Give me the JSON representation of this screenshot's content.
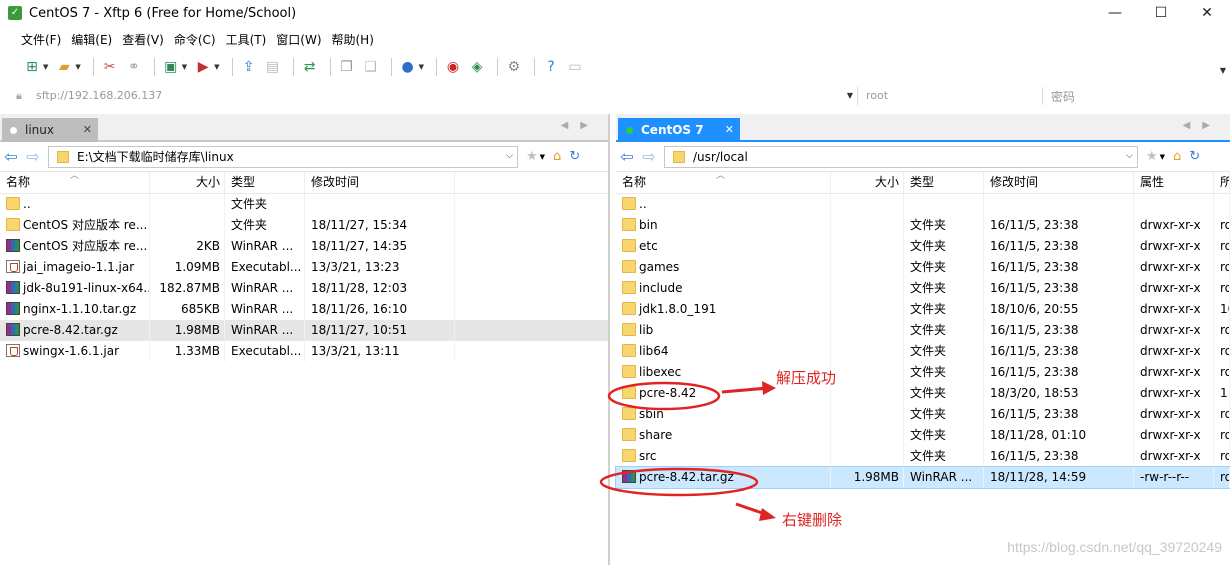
{
  "window": {
    "title": "CentOS 7 - Xftp 6 (Free for Home/School)",
    "controls": [
      "—",
      "☐",
      "✕"
    ]
  },
  "menu": [
    "文件(F)",
    "编辑(E)",
    "查看(V)",
    "命令(C)",
    "工具(T)",
    "窗口(W)",
    "帮助(H)"
  ],
  "address": {
    "host": "sftp://192.168.206.137",
    "user": "root",
    "password_placeholder": "密码"
  },
  "left_pane": {
    "tab_label": "linux",
    "path": "E:\\文档下载临时储存库\\linux",
    "columns": [
      "名称",
      "大小",
      "类型",
      "修改时间"
    ],
    "rows": [
      {
        "name": "..",
        "size": "",
        "type": "文件夹",
        "modified": "",
        "icon": "folder"
      },
      {
        "name": "CentOS 对应版本 re...",
        "size": "",
        "type": "文件夹",
        "modified": "18/11/27, 15:34",
        "icon": "folder"
      },
      {
        "name": "CentOS 对应版本 re...",
        "size": "2KB",
        "type": "WinRAR ...",
        "modified": "18/11/27, 14:35",
        "icon": "rar"
      },
      {
        "name": "jai_imageio-1.1.jar",
        "size": "1.09MB",
        "type": "Executabl...",
        "modified": "13/3/21, 13:23",
        "icon": "jar"
      },
      {
        "name": "jdk-8u191-linux-x64...",
        "size": "182.87MB",
        "type": "WinRAR ...",
        "modified": "18/11/28, 12:03",
        "icon": "rar"
      },
      {
        "name": "nginx-1.1.10.tar.gz",
        "size": "685KB",
        "type": "WinRAR ...",
        "modified": "18/11/26, 16:10",
        "icon": "rar"
      },
      {
        "name": "pcre-8.42.tar.gz",
        "size": "1.98MB",
        "type": "WinRAR ...",
        "modified": "18/11/27, 10:51",
        "icon": "rar",
        "selected": true
      },
      {
        "name": "swingx-1.6.1.jar",
        "size": "1.33MB",
        "type": "Executabl...",
        "modified": "13/3/21, 13:11",
        "icon": "jar"
      }
    ]
  },
  "right_pane": {
    "tab_label": "CentOS 7",
    "path": "/usr/local",
    "columns": [
      "名称",
      "大小",
      "类型",
      "修改时间",
      "属性",
      "所"
    ],
    "rows": [
      {
        "name": "..",
        "size": "",
        "type": "",
        "modified": "",
        "attr": "",
        "owner": "",
        "icon": "folder"
      },
      {
        "name": "bin",
        "size": "",
        "type": "文件夹",
        "modified": "16/11/5, 23:38",
        "attr": "drwxr-xr-x",
        "owner": "ro",
        "icon": "folder"
      },
      {
        "name": "etc",
        "size": "",
        "type": "文件夹",
        "modified": "16/11/5, 23:38",
        "attr": "drwxr-xr-x",
        "owner": "ro",
        "icon": "folder"
      },
      {
        "name": "games",
        "size": "",
        "type": "文件夹",
        "modified": "16/11/5, 23:38",
        "attr": "drwxr-xr-x",
        "owner": "ro",
        "icon": "folder"
      },
      {
        "name": "include",
        "size": "",
        "type": "文件夹",
        "modified": "16/11/5, 23:38",
        "attr": "drwxr-xr-x",
        "owner": "ro",
        "icon": "folder"
      },
      {
        "name": "jdk1.8.0_191",
        "size": "",
        "type": "文件夹",
        "modified": "18/10/6, 20:55",
        "attr": "drwxr-xr-x",
        "owner": "10",
        "icon": "folder"
      },
      {
        "name": "lib",
        "size": "",
        "type": "文件夹",
        "modified": "16/11/5, 23:38",
        "attr": "drwxr-xr-x",
        "owner": "ro",
        "icon": "folder"
      },
      {
        "name": "lib64",
        "size": "",
        "type": "文件夹",
        "modified": "16/11/5, 23:38",
        "attr": "drwxr-xr-x",
        "owner": "ro",
        "icon": "folder"
      },
      {
        "name": "libexec",
        "size": "",
        "type": "文件夹",
        "modified": "16/11/5, 23:38",
        "attr": "drwxr-xr-x",
        "owner": "ro",
        "icon": "folder"
      },
      {
        "name": "pcre-8.42",
        "size": "",
        "type": "文件夹",
        "modified": "18/3/20, 18:53",
        "attr": "drwxr-xr-x",
        "owner": "1",
        "icon": "folder"
      },
      {
        "name": "sbin",
        "size": "",
        "type": "文件夹",
        "modified": "16/11/5, 23:38",
        "attr": "drwxr-xr-x",
        "owner": "ro",
        "icon": "folder"
      },
      {
        "name": "share",
        "size": "",
        "type": "文件夹",
        "modified": "18/11/28, 01:10",
        "attr": "drwxr-xr-x",
        "owner": "ro",
        "icon": "folder"
      },
      {
        "name": "src",
        "size": "",
        "type": "文件夹",
        "modified": "16/11/5, 23:38",
        "attr": "drwxr-xr-x",
        "owner": "ro",
        "icon": "folder"
      },
      {
        "name": "pcre-8.42.tar.gz",
        "size": "1.98MB",
        "type": "WinRAR ...",
        "modified": "18/11/28, 14:59",
        "attr": "-rw-r--r--",
        "owner": "ro",
        "icon": "rar",
        "selected": true
      }
    ]
  },
  "annotations": {
    "extract_success": "解压成功",
    "right_click_delete": "右键删除",
    "color": "#e02424"
  },
  "watermark": "https://blog.csdn.net/qq_39720249"
}
